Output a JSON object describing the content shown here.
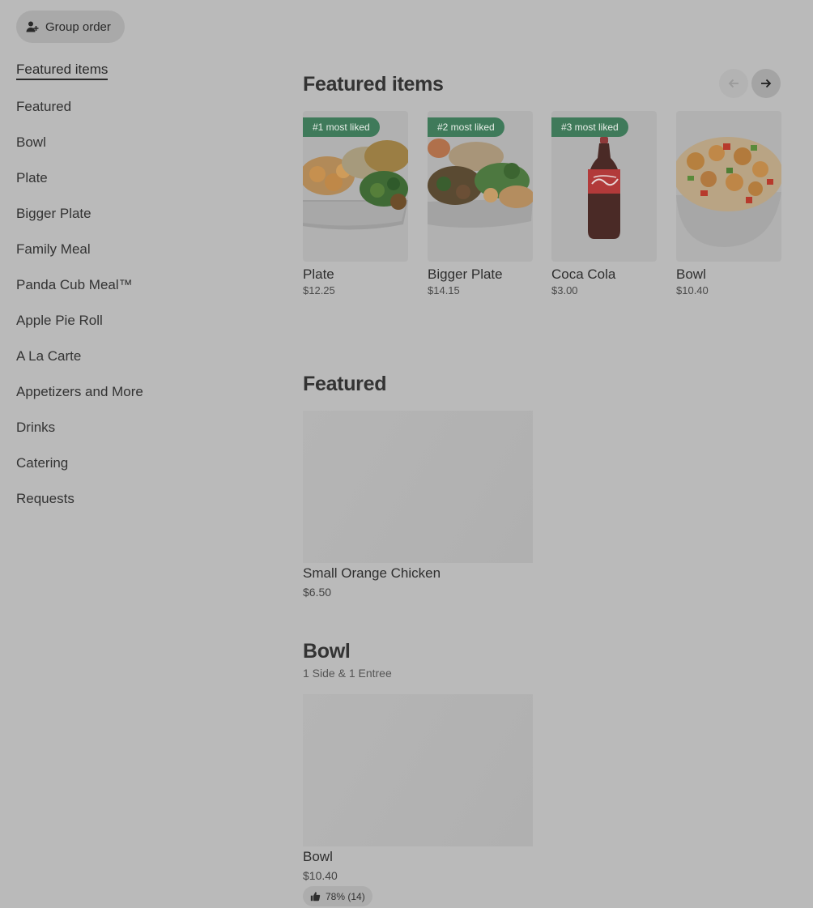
{
  "sidebar": {
    "group_order_label": "Group order",
    "active_label": "Featured items",
    "items": [
      {
        "label": "Featured"
      },
      {
        "label": "Bowl"
      },
      {
        "label": "Plate"
      },
      {
        "label": "Bigger Plate"
      },
      {
        "label": "Family Meal"
      },
      {
        "label": "Panda Cub Meal™"
      },
      {
        "label": "Apple Pie Roll"
      },
      {
        "label": "A La Carte"
      },
      {
        "label": "Appetizers and More"
      },
      {
        "label": "Drinks"
      },
      {
        "label": "Catering"
      },
      {
        "label": "Requests"
      }
    ]
  },
  "featured_items": {
    "title": "Featured items",
    "cards": [
      {
        "badge": "#1 most liked",
        "name": "Plate",
        "price": "$12.25"
      },
      {
        "badge": "#2 most liked",
        "name": "Bigger Plate",
        "price": "$14.15"
      },
      {
        "badge": "#3 most liked",
        "name": "Coca Cola",
        "price": "$3.00"
      },
      {
        "badge": "",
        "name": "Bowl",
        "price": "$10.40"
      }
    ]
  },
  "featured": {
    "title": "Featured",
    "item": {
      "name": "Small Orange Chicken",
      "price": "$6.50"
    }
  },
  "bowl": {
    "title": "Bowl",
    "subtitle": "1 Side & 1 Entree",
    "item": {
      "name": "Bowl",
      "price": "$10.40",
      "rating": "78% (14)"
    }
  },
  "colors": {
    "badge_green": "#3f7a5a",
    "overlay_gray": "#bababa"
  }
}
